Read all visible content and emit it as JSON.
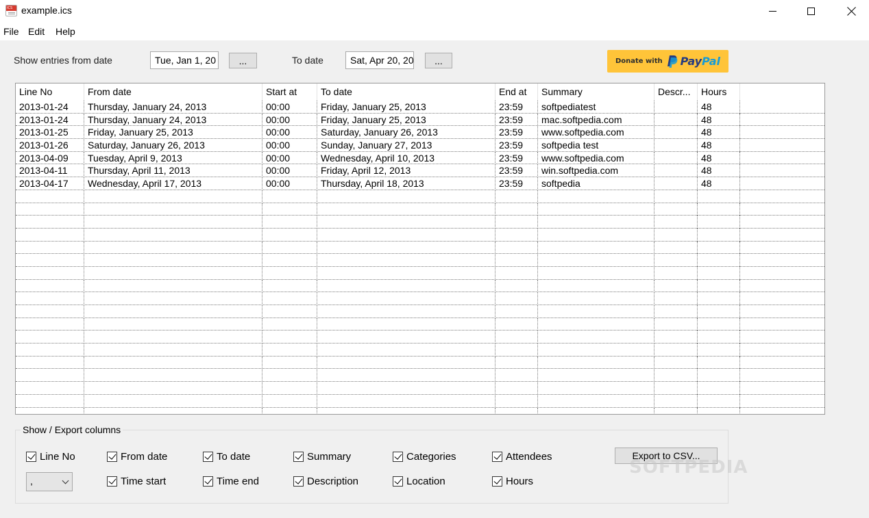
{
  "window": {
    "title": "example.ics"
  },
  "menu": [
    "File",
    "Edit",
    "Help"
  ],
  "filter": {
    "from_label": "Show entries from date",
    "from_value": "Tue, Jan 1, 20",
    "to_label": "To date",
    "to_value": "Sat, Apr 20, 20",
    "picker_label": "..."
  },
  "donate": {
    "text": "Donate with",
    "brand_pay": "Pay",
    "brand_pal": "Pal",
    "brand_color": "#ffc439"
  },
  "table": {
    "columns": [
      "Line No",
      "From date",
      "Start at",
      "To date",
      "End at",
      "Summary",
      "Descr...",
      "Hours"
    ],
    "rows": [
      [
        "2013-01-24",
        "Thursday, January 24, 2013",
        "00:00",
        "Friday, January 25, 2013",
        "23:59",
        "softpediatest",
        "",
        "48"
      ],
      [
        "2013-01-24",
        "Thursday, January 24, 2013",
        "00:00",
        "Friday, January 25, 2013",
        "23:59",
        "mac.softpedia.com",
        "",
        "48"
      ],
      [
        "2013-01-25",
        "Friday, January 25, 2013",
        "00:00",
        "Saturday, January 26, 2013",
        "23:59",
        "www.softpedia.com",
        "",
        "48"
      ],
      [
        "2013-01-26",
        "Saturday, January 26, 2013",
        "00:00",
        "Sunday, January 27, 2013",
        "23:59",
        "softpedia test",
        "",
        "48"
      ],
      [
        "2013-04-09",
        "Tuesday, April 9, 2013",
        "00:00",
        "Wednesday, April 10, 2013",
        "23:59",
        "www.softpedia.com",
        "",
        "48"
      ],
      [
        "2013-04-11",
        "Thursday, April 11, 2013",
        "00:00",
        "Friday, April 12, 2013",
        "23:59",
        "win.softpedia.com",
        "",
        "48"
      ],
      [
        "2013-04-17",
        "Wednesday, April 17, 2013",
        "00:00",
        "Thursday, April 18, 2013",
        "23:59",
        "softpedia",
        "",
        "48"
      ]
    ],
    "empty_rows": 18
  },
  "export": {
    "group_title": "Show / Export columns",
    "checkboxes": [
      {
        "label": "Line No",
        "checked": true
      },
      {
        "label": "From date",
        "checked": true
      },
      {
        "label": "To date",
        "checked": true
      },
      {
        "label": "Summary",
        "checked": true
      },
      {
        "label": "Categories",
        "checked": true
      },
      {
        "label": "Attendees",
        "checked": true
      },
      {
        "label": "Time start",
        "checked": true
      },
      {
        "label": "Time end",
        "checked": true
      },
      {
        "label": "Description",
        "checked": true
      },
      {
        "label": "Location",
        "checked": true
      },
      {
        "label": "Hours",
        "checked": true
      }
    ],
    "separator_value": ",",
    "export_button": "Export to CSV..."
  },
  "watermark": "SOFTPEDIA"
}
